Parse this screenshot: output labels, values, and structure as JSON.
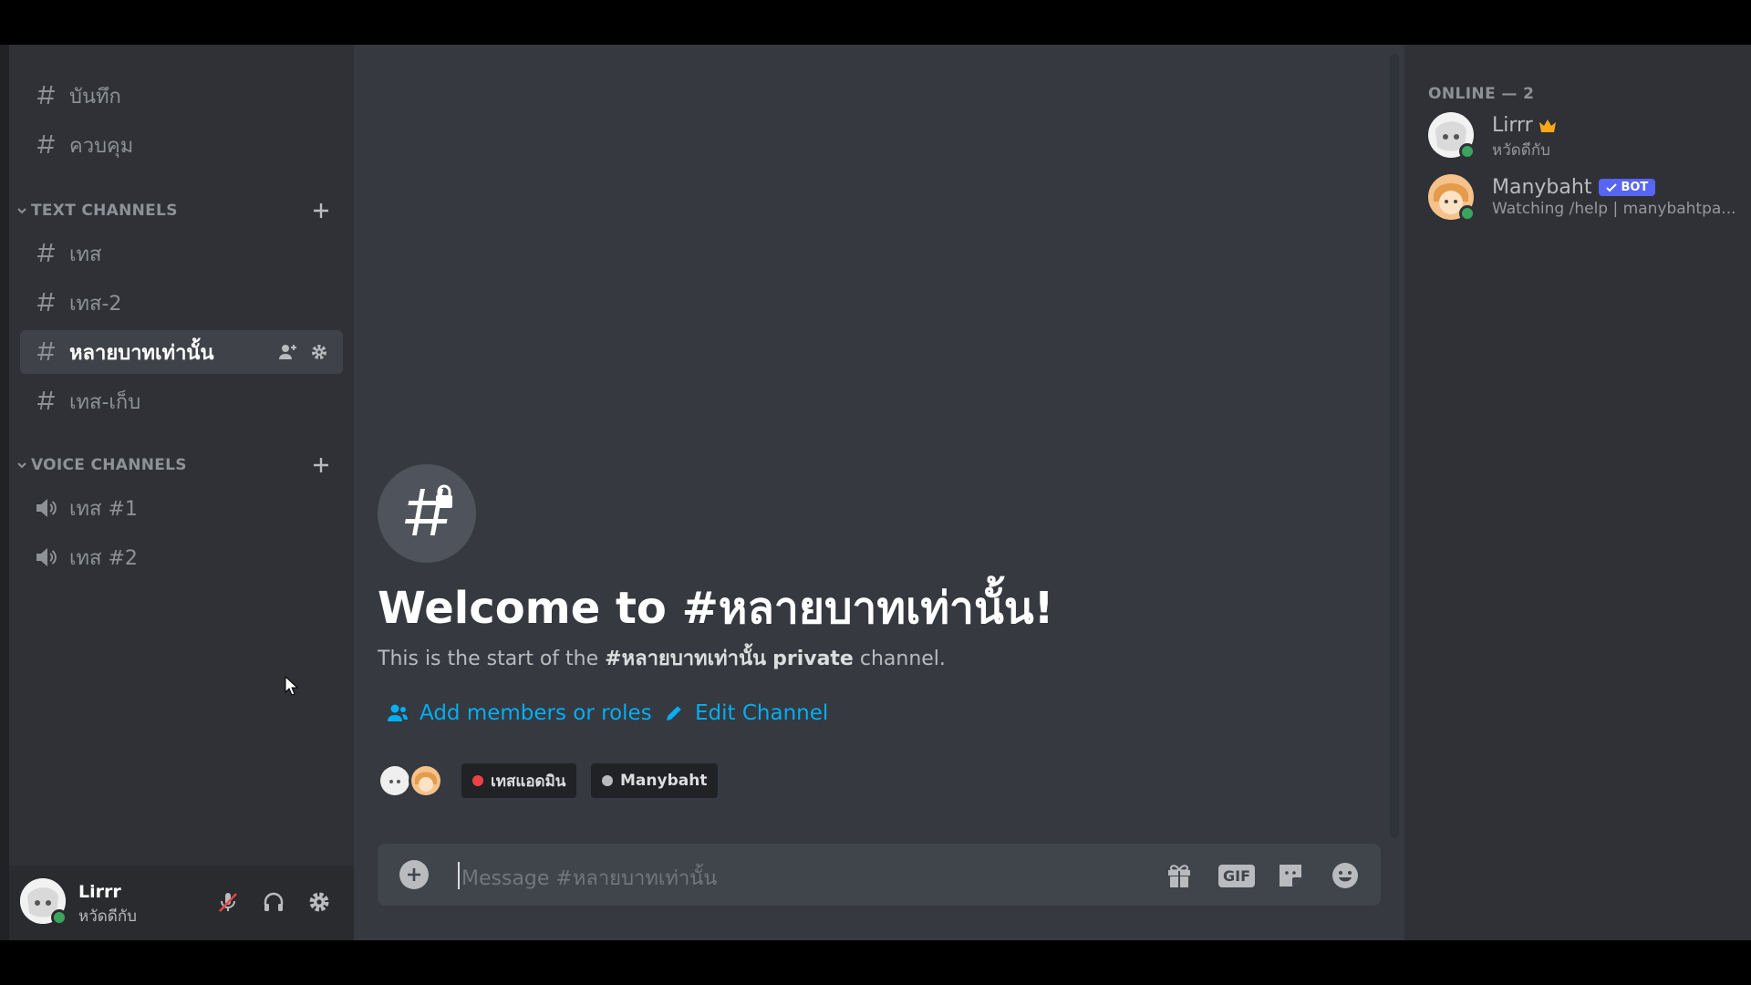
{
  "sidebar": {
    "top_channels": [
      {
        "label": "บันทึก"
      },
      {
        "label": "ควบคุม"
      }
    ],
    "text_category": "TEXT CHANNELS",
    "text_channels": [
      {
        "label": "เทส"
      },
      {
        "label": "เทส-2"
      },
      {
        "label": "หลายบาทเท่านั้น"
      },
      {
        "label": "เทส-เก็บ"
      }
    ],
    "voice_category": "VOICE CHANNELS",
    "voice_channels": [
      {
        "label": "เทส #1"
      },
      {
        "label": "เทส #2"
      }
    ]
  },
  "user": {
    "name": "Lirrr",
    "status": "หวัดดีกับ"
  },
  "welcome": {
    "title": "Welcome to #หลายบาทเท่านั้น!",
    "desc_prefix": "This is the start of the ",
    "desc_channel": "#หลายบาทเท่านั้น",
    "desc_private": "private",
    "desc_suffix": " channel.",
    "add_members": "Add members or roles",
    "edit_channel": "Edit Channel",
    "roles": [
      {
        "label": "เทสแอดมิน",
        "color": "#ed4245"
      },
      {
        "label": "Manybaht",
        "color": "#b9bbbe"
      }
    ]
  },
  "composer": {
    "placeholder": "Message #หลายบาทเท่านั้น",
    "gif_label": "GIF"
  },
  "members": {
    "header": "ONLINE — 2",
    "list": [
      {
        "name": "Lirrr",
        "sub": "หวัดดีกับ"
      },
      {
        "name": "Manybaht",
        "badge": "BOT",
        "sub": "Watching /help | manybahtpa..."
      }
    ]
  },
  "colors": {
    "accent": "#00aff4",
    "online": "#3ba55d",
    "bot": "#5865f2"
  }
}
